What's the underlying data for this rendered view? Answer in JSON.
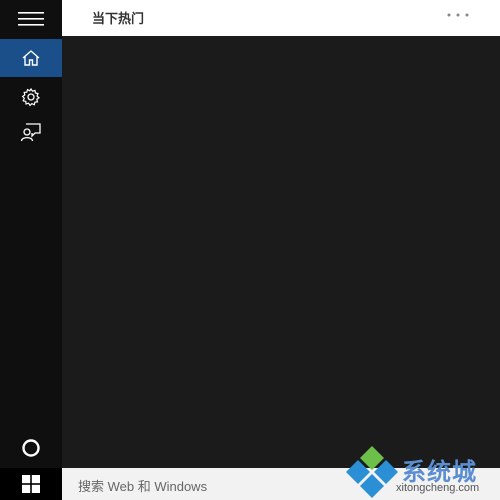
{
  "header": {
    "title": "当下热门"
  },
  "search": {
    "placeholder": "搜索 Web 和 Windows"
  },
  "rail": {
    "items": [
      {
        "icon": "hamburger-menu-icon"
      },
      {
        "icon": "home-icon",
        "selected": true
      },
      {
        "icon": "settings-gear-icon"
      },
      {
        "icon": "feedback-icon"
      },
      {
        "icon": "cortana-circle-icon"
      }
    ]
  },
  "watermark": {
    "brand": "系统城",
    "url": "xitongcheng.com"
  },
  "colors": {
    "selected_accent": "#1b4f8a",
    "content_bg": "#1b1b1b",
    "rail_bg": "#0f0f0f"
  }
}
